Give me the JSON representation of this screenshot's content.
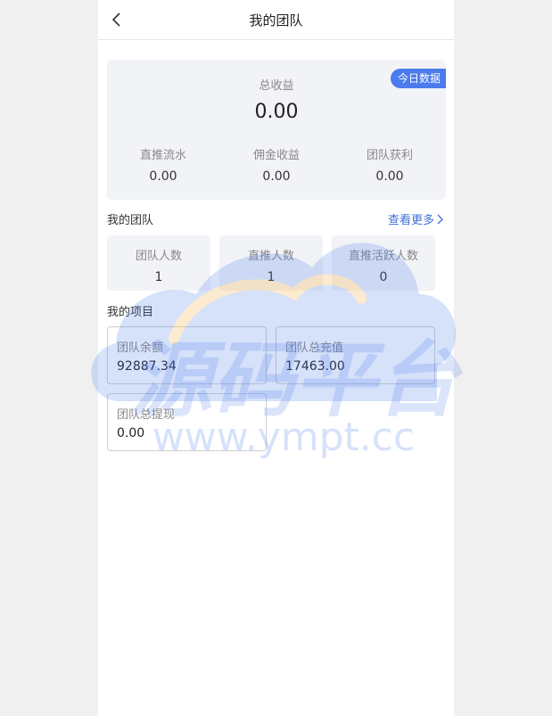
{
  "header": {
    "title": "我的团队"
  },
  "summary": {
    "badge": "今日数据",
    "total_label": "总收益",
    "total_value": "0.00",
    "stats": [
      {
        "label": "直推流水",
        "value": "0.00"
      },
      {
        "label": "佣金收益",
        "value": "0.00"
      },
      {
        "label": "团队获利",
        "value": "0.00"
      }
    ]
  },
  "team": {
    "title": "我的团队",
    "more_label": "查看更多",
    "boxes": [
      {
        "label": "团队人数",
        "value": "1"
      },
      {
        "label": "直推人数",
        "value": "1"
      },
      {
        "label": "直推活跃人数",
        "value": "0"
      }
    ]
  },
  "project": {
    "title": "我的项目",
    "boxes": [
      {
        "label": "团队余额",
        "value": "92887.34"
      },
      {
        "label": "团队总充值",
        "value": "17463.00"
      },
      {
        "label": "团队总提现",
        "value": "0.00"
      }
    ]
  },
  "watermark": {
    "text": "源码平台",
    "url": "www.ympt.cc"
  },
  "colors": {
    "accent": "#4b7bec",
    "link": "#3e6fd8",
    "card_bg": "#f2f3f7"
  },
  "icons": {
    "back": "chevron-left-icon",
    "more": "chevron-right-icon"
  }
}
